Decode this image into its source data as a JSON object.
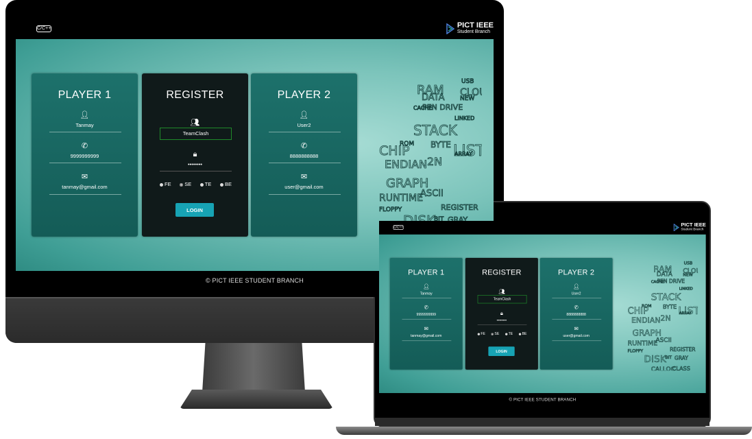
{
  "header": {
    "left_logo": "C/C++",
    "right_logo_title": "PICT IEEE",
    "right_logo_subtitle": "Student Branch"
  },
  "player1": {
    "title": "PLAYER 1",
    "name": "Tanmay",
    "phone": "9999999999",
    "email": "tanmay@gmail.com"
  },
  "register": {
    "title": "REGISTER",
    "team": "TeamClash",
    "password": "••••••••",
    "years": [
      "FE",
      "SE",
      "TE",
      "BE"
    ],
    "selected_year": "SE",
    "login_label": "LOGIN"
  },
  "player2": {
    "title": "PLAYER 2",
    "name": "User2",
    "phone": "8888888888",
    "email": "user@gmail.com"
  },
  "footer": "© PICT IEEE STUDENT BRANCH",
  "word_cloud": [
    "RAM",
    "USB",
    "CLOUD",
    "DATA",
    "NEW",
    "CACHE",
    "PEN DRIVE",
    "STACK",
    "LINKED",
    "CHIP",
    "ROM",
    "BYTE",
    "LIST",
    "ENDIAN",
    "2N",
    "ARRAY",
    "GRAPH",
    "RUNTIME",
    "ASCII",
    "FLOPPY",
    "DISK",
    "REGISTER",
    "BIT",
    "GRAY",
    "CALLOC",
    "CLASS"
  ],
  "colors": {
    "panel": "#1d716b",
    "register_panel": "#101a1a",
    "login_button": "#17a3b4",
    "team_border": "#1f8a2a",
    "background": "#7cc4bb"
  }
}
